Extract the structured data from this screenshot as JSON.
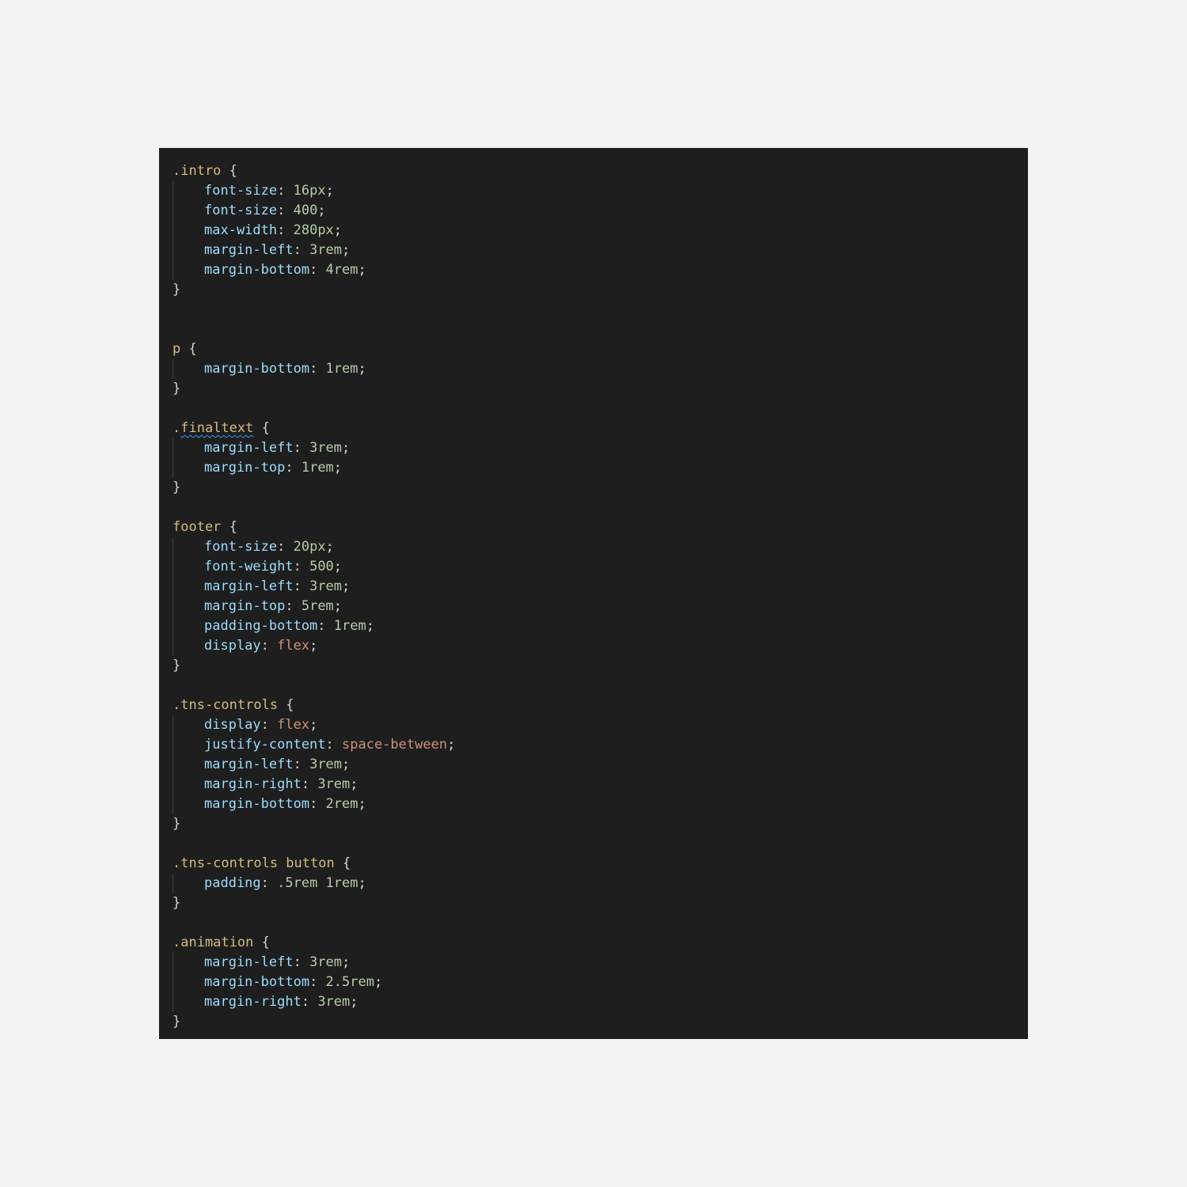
{
  "code": {
    "intro": {
      "selector": ".intro",
      "decls": [
        {
          "prop": "font-size",
          "value": "16px"
        },
        {
          "prop": "font-size",
          "value": "400"
        },
        {
          "prop": "max-width",
          "value": "280px"
        },
        {
          "prop": "margin-left",
          "value": "3rem"
        },
        {
          "prop": "margin-bottom",
          "value": "4rem"
        }
      ]
    },
    "p": {
      "selector": "p",
      "decls": [
        {
          "prop": "margin-bottom",
          "value": "1rem"
        }
      ]
    },
    "finaltext": {
      "selector_dot": ".",
      "selector_name": "finaltext",
      "decls": [
        {
          "prop": "margin-left",
          "value": "3rem"
        },
        {
          "prop": "margin-top",
          "value": "1rem"
        }
      ]
    },
    "footer": {
      "selector": "footer",
      "decls": [
        {
          "prop": "font-size",
          "value": "20px"
        },
        {
          "prop": "font-weight",
          "value": "500"
        },
        {
          "prop": "margin-left",
          "value": "3rem"
        },
        {
          "prop": "margin-top",
          "value": "5rem"
        },
        {
          "prop": "padding-bottom",
          "value": "1rem"
        },
        {
          "prop": "display",
          "value": "flex"
        }
      ]
    },
    "tns_controls": {
      "selector": ".tns-controls",
      "decls": [
        {
          "prop": "display",
          "value": "flex"
        },
        {
          "prop": "justify-content",
          "value": "space-between"
        },
        {
          "prop": "margin-left",
          "value": "3rem"
        },
        {
          "prop": "margin-right",
          "value": "3rem"
        },
        {
          "prop": "margin-bottom",
          "value": "2rem"
        }
      ]
    },
    "tns_button": {
      "selector": ".tns-controls button",
      "decls": [
        {
          "prop": "padding",
          "value": ".5rem 1rem"
        }
      ]
    },
    "animation": {
      "selector": ".animation",
      "decls": [
        {
          "prop": "margin-left",
          "value": "3rem"
        },
        {
          "prop": "margin-bottom",
          "value": "2.5rem"
        },
        {
          "prop": "margin-right",
          "value": "3rem"
        }
      ]
    }
  },
  "colors": {
    "page_background": "#f2f2f2",
    "editor_background": "#1e1e1e",
    "selector": "#d7ba7d",
    "property": "#9cdcfe",
    "number": "#b5cea8",
    "keyword_value": "#ce9178",
    "punctuation": "#d4d4d4",
    "squiggle": "#3794ff"
  }
}
